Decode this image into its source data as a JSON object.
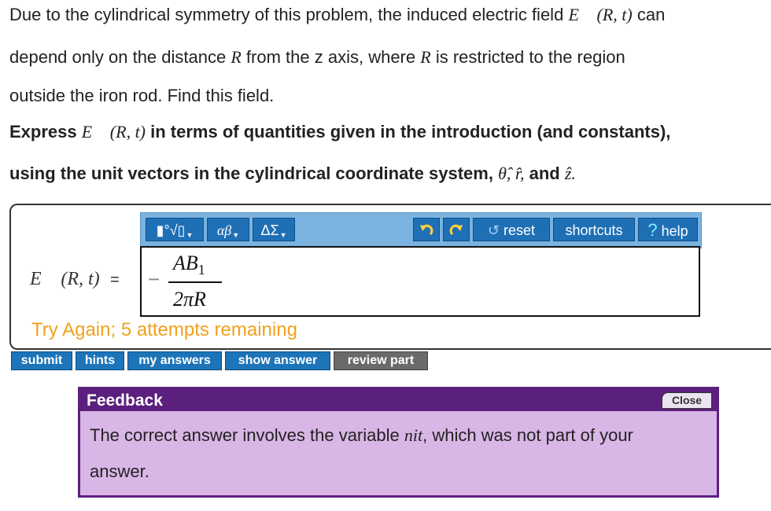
{
  "question": {
    "line1": "Due to the cylindrical symmetry of this problem, the induced electric field",
    "line1_math": "E⃗ (R, t)",
    "line1_end": "can",
    "line2_a": "depend only on the distance",
    "line2_math1": "R",
    "line2_b": "from the z axis, where",
    "line2_math2": "R",
    "line2_c": "is restricted to the region",
    "line3": "outside the iron rod. Find this field.",
    "express_a": "Express",
    "express_math": "E⃗ (R, t)",
    "express_b": "in terms of quantities given in the introduction (and constants),",
    "units_a": "using the unit vectors in the cylindrical coordinate system,",
    "units_math": "θ̂, r̂,",
    "units_b": "and",
    "units_math2": "ẑ."
  },
  "toolbar": {
    "templates_label": "▮°√▯",
    "greek_label": "αβ",
    "symbols_label": "ΔΣ",
    "undo_icon": "undo-icon",
    "redo_icon": "redo-icon",
    "reset_label": "reset",
    "shortcuts_label": "shortcuts",
    "help_label": "help"
  },
  "answer": {
    "lhs": "E⃗ (R, t)",
    "equals": "=",
    "minus": "−",
    "numerator": "AB",
    "numerator_sub": "1",
    "denominator": "2πR",
    "status": "Try Again; 5 attempts remaining"
  },
  "actions": {
    "submit": "submit",
    "hints": "hints",
    "my_answers": "my answers",
    "show_answer": "show answer",
    "review_part": "review part"
  },
  "feedback": {
    "title": "Feedback",
    "close": "Close",
    "text_a": "The correct answer involves the variable",
    "text_math": "nit",
    "text_b": ", which was not part of your",
    "text_line2": "answer."
  },
  "colors": {
    "toolbar_bg": "#7ab3e0",
    "button_blue": "#1f6fb5",
    "try_again": "#f0a21c",
    "feedback_header": "#5b1f7d",
    "feedback_bg": "#d8b6e6"
  }
}
